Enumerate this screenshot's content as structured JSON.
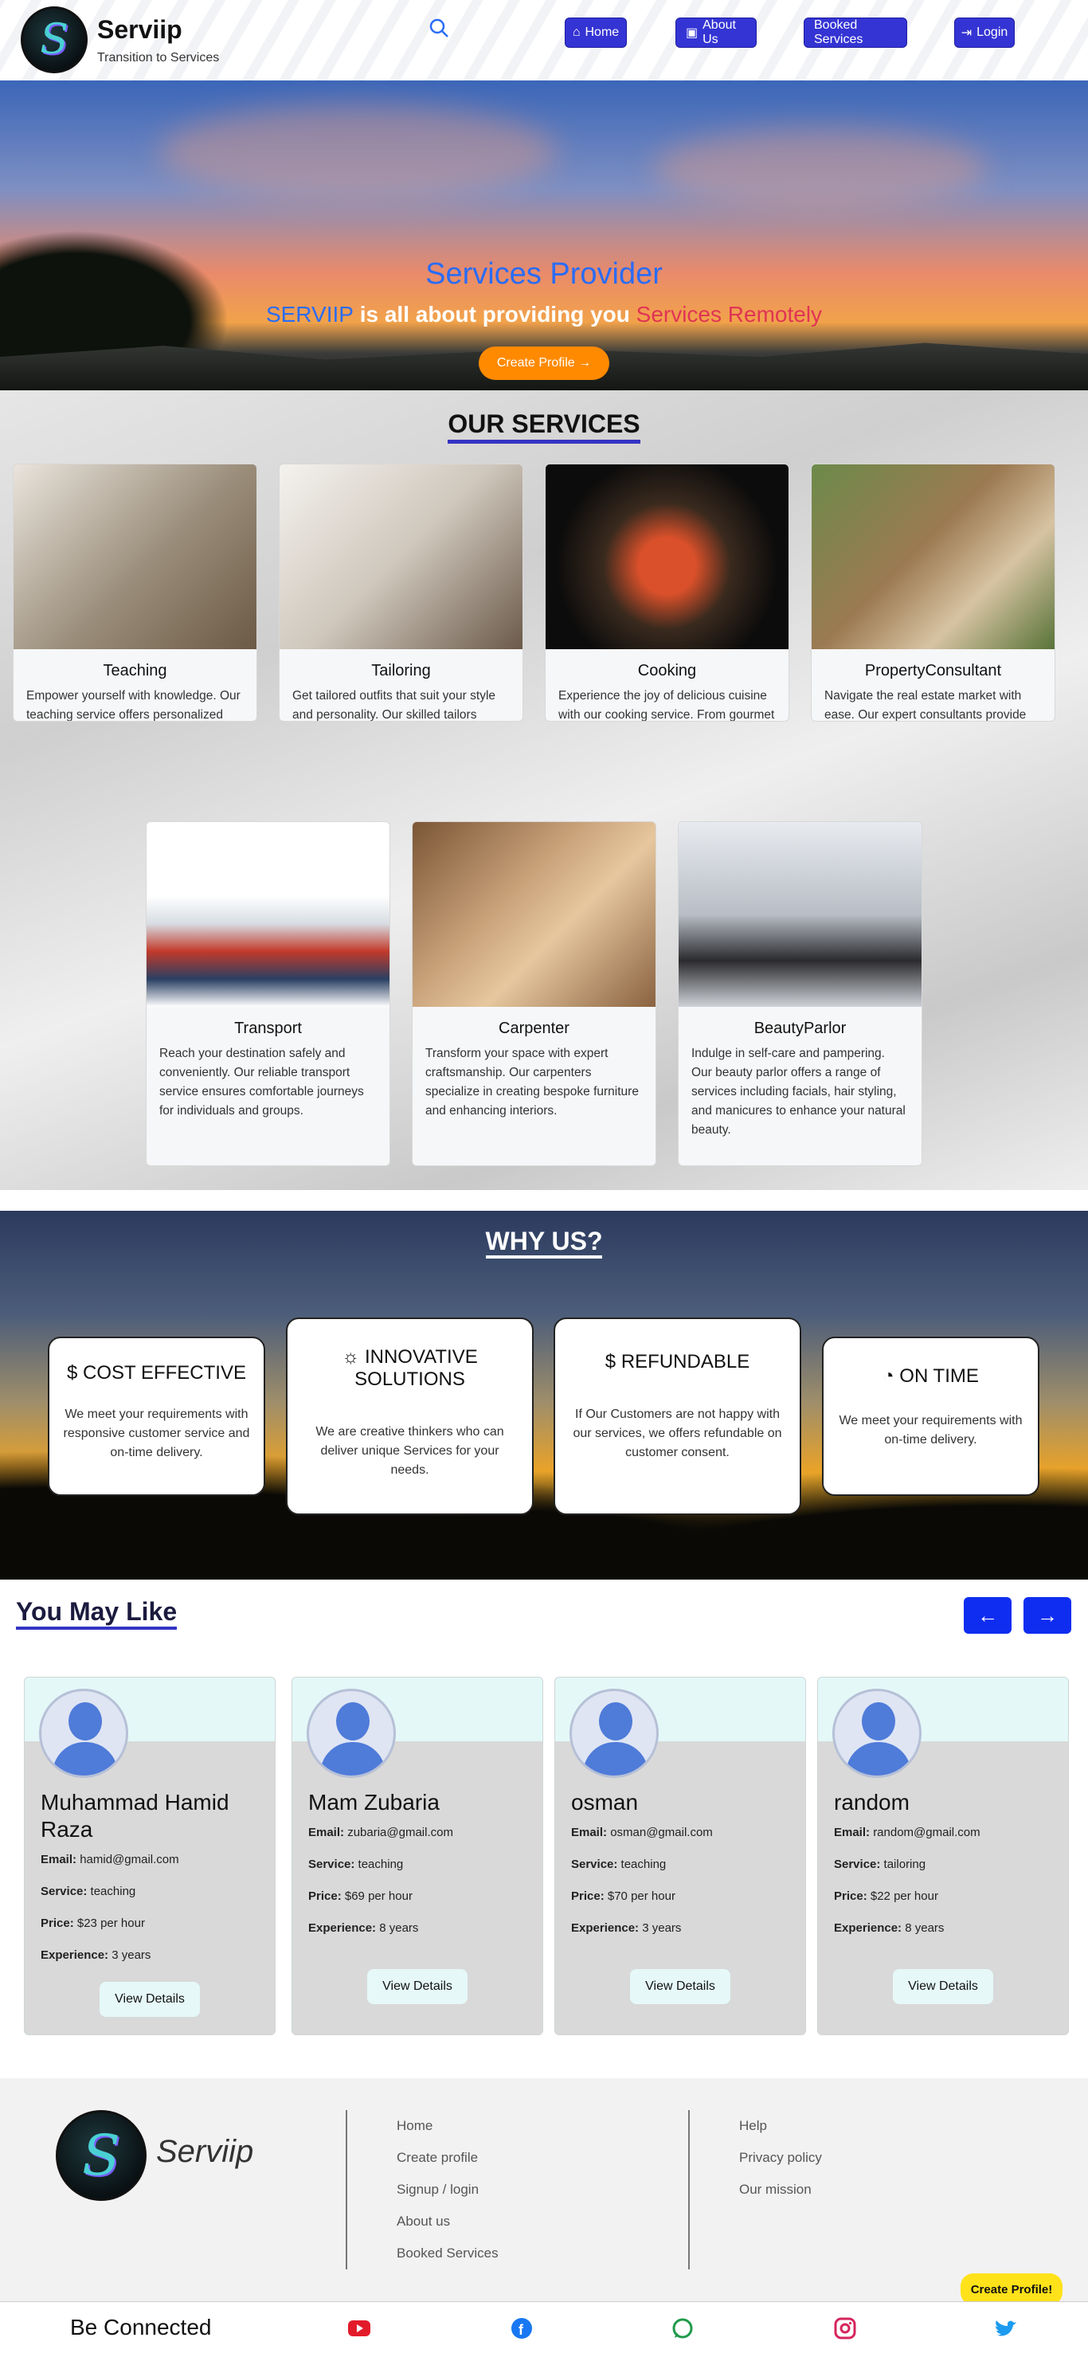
{
  "brand": {
    "name": "Serviip",
    "tagline": "Transition to Services",
    "logo_letter": "S"
  },
  "nav": {
    "search_icon": "search-icon",
    "home": "Home",
    "about": "About Us",
    "booked": "Booked Services",
    "login": "Login"
  },
  "hero": {
    "title": "Services Provider",
    "sub_a": "SERVIIP",
    "sub_b": " is all about providing you ",
    "sub_c": "Services Remotely",
    "cta": "Create Profile →"
  },
  "services": {
    "title": "OUR SERVICES",
    "cards": [
      {
        "name": "Teaching",
        "desc": "Empower yourself with knowledge. Our teaching service offers personalized education in various subjects."
      },
      {
        "name": "Tailoring",
        "desc": "Get tailored outfits that suit your style and personality. Our skilled tailors ensure a perfect fit for every stitch."
      },
      {
        "name": "Cooking",
        "desc": "Experience the joy of delicious cuisine with our cooking service. From gourmet meals to traditional dishes, we cater to all tastes."
      },
      {
        "name": "PropertyConsultant",
        "desc": "Navigate the real estate market with ease. Our expert consultants provide valuable insights and guidance for your property needs."
      },
      {
        "name": "Transport",
        "desc": "Reach your destination safely and conveniently. Our reliable transport service ensures comfortable journeys for individuals and groups."
      },
      {
        "name": "Carpenter",
        "desc": "Transform your space with expert craftsmanship. Our carpenters specialize in creating bespoke furniture and enhancing interiors."
      },
      {
        "name": "BeautyParlor",
        "desc": "Indulge in self-care and pampering. Our beauty parlor offers a range of services including facials, hair styling, and manicures to enhance your natural beauty."
      }
    ]
  },
  "why": {
    "title": "WHY US?",
    "cards": [
      {
        "icon": "$",
        "title": "COST EFFECTIVE",
        "desc": "We meet your requirements with responsive customer service and on-time delivery."
      },
      {
        "icon": "☼",
        "title": "INNOVATIVE SOLUTIONS",
        "desc": "We are creative thinkers who can deliver unique Services for your needs."
      },
      {
        "icon": "$",
        "title": "REFUNDABLE",
        "desc": "If Our Customers are not happy with our services, we offers refundable on customer consent."
      },
      {
        "icon": "◔",
        "title": "ON TIME",
        "desc": "We meet your requirements with on-time delivery."
      }
    ]
  },
  "like": {
    "title": "You May Like",
    "prev": "←",
    "next": "→",
    "labels": {
      "email": "Email:",
      "service": "Service:",
      "price": "Price:",
      "experience": "Experience:"
    },
    "view": "View Details",
    "profiles": [
      {
        "name": "Muhammad Hamid Raza",
        "email": "hamid@gmail.com",
        "service": "teaching",
        "price": "$23 per hour",
        "experience": "3 years"
      },
      {
        "name": "Mam Zubaria",
        "email": "zubaria@gmail.com",
        "service": "teaching",
        "price": "$69 per hour",
        "experience": "8 years"
      },
      {
        "name": "osman",
        "email": "osman@gmail.com",
        "service": "teaching",
        "price": "$70 per hour",
        "experience": "3 years"
      },
      {
        "name": "random",
        "email": "random@gmail.com",
        "service": "tailoring",
        "price": "$22 per hour",
        "experience": "8 years"
      }
    ]
  },
  "footer": {
    "brand": "Serviip",
    "links_a": [
      "Home",
      "Create profile",
      "Signup / login",
      "About us",
      "Booked Services"
    ],
    "links_b": [
      "Help",
      "Privacy policy",
      "Our mission"
    ],
    "cta": "Create Profile!",
    "connected": "Be Connected",
    "social": [
      "youtube-icon",
      "facebook-icon",
      "whatsapp-icon",
      "instagram-icon",
      "twitter-icon"
    ]
  }
}
